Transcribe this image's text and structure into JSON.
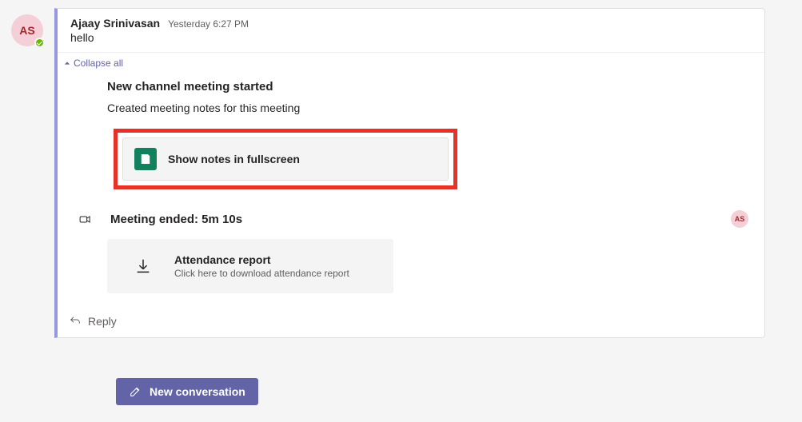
{
  "avatar": {
    "initials": "AS",
    "author": "Ajaay Srinivasan",
    "timestamp": "Yesterday 6:27 PM"
  },
  "message": {
    "text": "hello"
  },
  "collapse": {
    "label": "Collapse all"
  },
  "meeting": {
    "title": "New channel meeting started",
    "subtitle": "Created meeting notes for this meeting",
    "notes_button": "Show notes in fullscreen"
  },
  "ended": {
    "text": "Meeting ended: 5m 10s",
    "mini_initials": "AS"
  },
  "attendance": {
    "title": "Attendance report",
    "subtitle": "Click here to download attendance report"
  },
  "reply": {
    "label": "Reply"
  },
  "new_conversation": {
    "label": "New conversation"
  }
}
